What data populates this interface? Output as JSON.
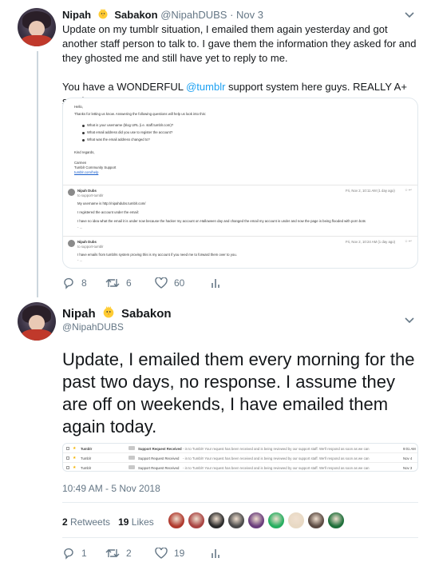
{
  "tweet1": {
    "display_name": "Nipah",
    "display_name_suffix": "Sabakon",
    "handle": "@NipahDUBS",
    "date": "· Nov 3",
    "text_part1": "Update on my tumblr situation, I emailed them again yesterday and got another staff person to talk to. I gave them the information they asked for and they ghosted me and still have yet to reply to me.\n\nYou have a WONDERFUL ",
    "mention": "@tumblr",
    "text_part2": " support system here guys. REALLY A+ service.",
    "email": {
      "greeting": "Hello,",
      "intro": "Thanks for letting us know. Answering the following questions will help us look into this:",
      "questions": [
        "What is your username (blog URL (i.e. staff.tumblr.com)?",
        "What email address did you use to register the account?",
        "What was the email address changed to?"
      ],
      "regards": "Kind regards,",
      "signature": [
        "Carmen",
        "Tumblr Community Support"
      ],
      "signature_link": "tumblr.com/help",
      "reply1": {
        "sender": "Nipah Dubs",
        "to": "to support-tumblr",
        "date": "Fri, Nov 2, 10:11 AM (1 day ago)",
        "lines": [
          "My username is http://nipahdubs.tumblr.com/",
          "I registered the account under the email:",
          "I have no idea what the email it is under now because the hacker my account on Halloween day and changed the email my account is under and now the page is being flooded with porn bots",
          "- ..."
        ]
      },
      "reply2": {
        "sender": "Nipah Dubs",
        "to": "to support-tumblr",
        "date": "Fri, Nov 2, 10:24 AM (1 day ago)",
        "lines": [
          "I have emails from tumblrs system proving this is my account if you need me to forward them over to you.",
          "- ..."
        ]
      }
    },
    "actions": {
      "replies": "8",
      "retweets": "6",
      "likes": "60"
    }
  },
  "tweet2": {
    "display_name": "Nipah",
    "display_name_suffix": "Sabakon",
    "handle": "@NipahDUBS",
    "text": "Update, I emailed them every morning for the past two days, no response. I assume they are off on weekends, I have emailed them again today.",
    "inbox": [
      {
        "sender": "Tumblr",
        "subject": "Support Request Received",
        "preview": "- in to Tumblr! Your request has been received and is being reviewed by our support staff. We'll respond as soon as we can",
        "date": "9:01 AM"
      },
      {
        "sender": "Tumblr",
        "subject": "Support Request Received",
        "preview": "- in to Tumblr! Your request has been received and is being reviewed by our support staff. We'll respond as soon as we can",
        "date": "Nov 4"
      },
      {
        "sender": "Tumblr",
        "subject": "Support Request Received",
        "preview": "- in to Tumblr! Your request has been received and is being reviewed by our support staff. We'll respond as soon as we can",
        "date": "Nov 3"
      }
    ],
    "timestamp": "10:49 AM - 5 Nov 2018",
    "retweets_count": "2",
    "retweets_label": "Retweets",
    "likes_count": "19",
    "likes_label": "Likes",
    "liker_colors": [
      "#b03a2e",
      "#a94442",
      "#2b2b2b",
      "#4a4a4a",
      "#6a3d7c",
      "#27ae60",
      "#e8d9c4",
      "#5b4a42",
      "#1f6f3a"
    ],
    "actions": {
      "replies": "1",
      "retweets": "2",
      "likes": "19"
    }
  },
  "colors": {
    "accent": "#1da1f2",
    "muted": "#657786"
  }
}
